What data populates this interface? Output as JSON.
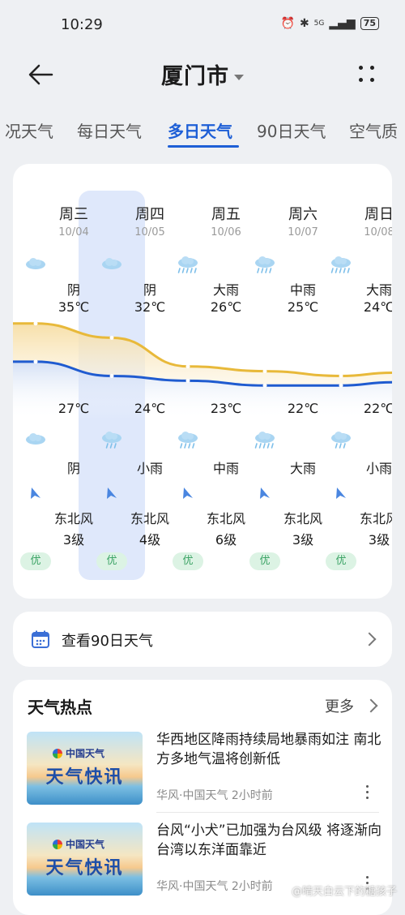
{
  "status_bar": {
    "time": "10:29",
    "battery": "75",
    "network": "5G"
  },
  "header": {
    "city": "厦门市"
  },
  "tabs": [
    {
      "label": "况天气"
    },
    {
      "label": "每日天气"
    },
    {
      "label": "多日天气",
      "active": true
    },
    {
      "label": "90日天气"
    },
    {
      "label": "空气质"
    }
  ],
  "forecast": {
    "days": [
      {
        "day": "周三",
        "date": "10/04",
        "day_condition": "阴",
        "day_icon": "cloud-icon",
        "high": "35℃",
        "low": "27℃",
        "night_icon": "cloud-icon",
        "night_condition": "阴",
        "wind_dir": "东北风",
        "wind_level": "3级",
        "aqi": "优"
      },
      {
        "day": "周四",
        "date": "10/05",
        "day_condition": "阴",
        "day_icon": "cloud-icon",
        "high": "32℃",
        "low": "24℃",
        "night_icon": "light-rain-icon",
        "night_condition": "小雨",
        "wind_dir": "东北风",
        "wind_level": "4级",
        "aqi": "优"
      },
      {
        "day": "周五",
        "date": "10/06",
        "day_condition": "大雨",
        "day_icon": "heavy-rain-icon",
        "high": "26℃",
        "low": "23℃",
        "night_icon": "moderate-rain-icon",
        "night_condition": "中雨",
        "wind_dir": "东北风",
        "wind_level": "6级",
        "aqi": "优"
      },
      {
        "day": "周六",
        "date": "10/07",
        "day_condition": "中雨",
        "day_icon": "moderate-rain-icon",
        "high": "25℃",
        "low": "22℃",
        "night_icon": "heavy-rain-icon",
        "night_condition": "大雨",
        "wind_dir": "东北风",
        "wind_level": "3级",
        "aqi": "优"
      },
      {
        "day": "周日",
        "date": "10/08",
        "day_condition": "大雨",
        "day_icon": "heavy-rain-icon",
        "high": "24℃",
        "low": "22℃",
        "night_icon": "light-rain-icon",
        "night_condition": "小雨",
        "wind_dir": "东北风",
        "wind_level": "3级",
        "aqi": "优"
      }
    ],
    "high_values": [
      35,
      32,
      26,
      25,
      24
    ],
    "low_values": [
      27,
      24,
      23,
      22,
      22
    ],
    "colors": {
      "high_line": "#e8b93a",
      "low_line": "#1f5bd0",
      "aqi_bg": "#dcf3e4",
      "aqi_text": "#3aa364",
      "highlight": "#dfe8fb"
    }
  },
  "ninety_day": {
    "label": "查看90日天气"
  },
  "hot": {
    "title": "天气热点",
    "more": "更多",
    "items": [
      {
        "thumb_logo": "中国天气",
        "thumb_title": "天气快讯",
        "title": "华西地区降雨持续局地暴雨如注 南北方多地气温将创新低",
        "meta": "华风·中国天气  2小时前"
      },
      {
        "thumb_logo": "中国天气",
        "thumb_title": "天气快讯",
        "title": "台风“小犬”已加强为台风级 将逐渐向台湾以东洋面靠近",
        "meta": "华风·中国天气  2小时前"
      }
    ],
    "watermark": "@晴天白云下的糖孩子"
  }
}
